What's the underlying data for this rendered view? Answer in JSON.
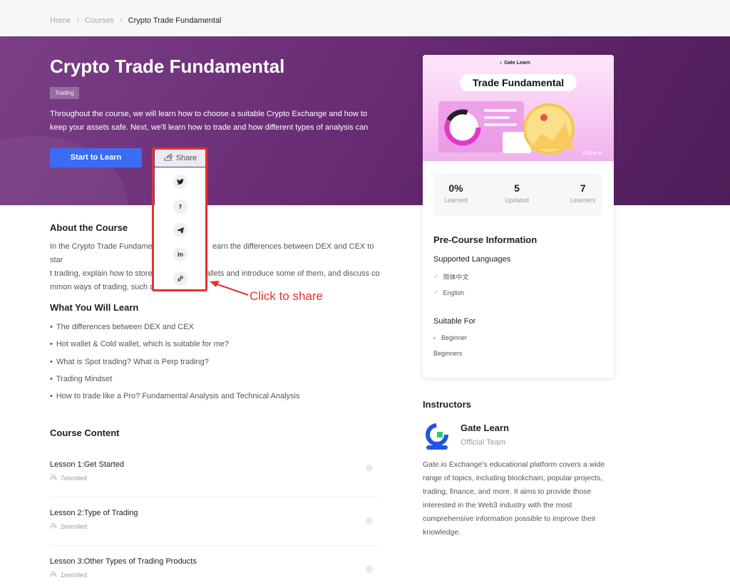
{
  "breadcrumb": {
    "items": [
      "Home",
      "Courses",
      "Crypto Trade Fundamental"
    ],
    "separator": "›"
  },
  "hero": {
    "title": "Crypto Trade Fundamental",
    "tag": "Trading",
    "description": "Throughout the course, we will learn how to choose a suitable Crypto Exchange and how to keep your assets safe. Next, we'll learn how to trade and how different types of analysis can help you m",
    "start_button": "Start to Learn",
    "share_button": "Share"
  },
  "share_menu": {
    "items": [
      "twitter",
      "facebook",
      "telegram",
      "linkedin",
      "link"
    ],
    "item_glyphs": [
      "𝕥",
      "f",
      "➤",
      "in",
      "⛓"
    ]
  },
  "annotation": {
    "label": "Click to share",
    "color": "#e5312f"
  },
  "about": {
    "title": "About the Course",
    "text_left": "In the Crypto Trade Fundamen",
    "text_right": "earn the differences between DEX and CEX to star",
    "line2_left": "t trading, explain how to store",
    "line2_right": "allets and introduce some of them, and discuss co",
    "line3_left": "mmon ways of trading, such a"
  },
  "learn": {
    "title": "What You Will Learn",
    "items": [
      "The differences between DEX and CEX",
      "Hot wallet & Cold wallet, which is suitable for me?",
      "What is Spot trading? What is Perp trading?",
      "Trading Mindset",
      "How to trade like a Pro? Fundamental Analysis and Technical Analysis"
    ]
  },
  "content": {
    "title": "Course Content",
    "lessons": [
      {
        "name": "Lesson 1:Get Started",
        "enrolled": "7enrolled"
      },
      {
        "name": "Lesson 2:Type of Trading",
        "enrolled": "2enrolled"
      },
      {
        "name": "Lesson 3:Other Types of Trading Products",
        "enrolled": "1enrolled"
      }
    ]
  },
  "card": {
    "logo": "Gate Learn",
    "banner_title": "Trade Fundamental",
    "stats": [
      {
        "value": "0%",
        "label": "Learned"
      },
      {
        "value": "5",
        "label": "Updated"
      },
      {
        "value": "7",
        "label": "Learners"
      }
    ],
    "pre_title": "Pre-Course Information",
    "languages_title": "Supported Languages",
    "languages": [
      "简体中文",
      "English"
    ],
    "suitable_title": "Suitable For",
    "suitable_level": "Beginner",
    "suitable_note": "Beginners"
  },
  "instructors": {
    "title": "Instructors",
    "name": "Gate Learn",
    "role": "Official Team",
    "description": "Gate.io Exchange's educational platform covers a wide range of topics, including blockchain, popular projects, trading, finance, and more. It aims to provide those interested in the Web3 industry with the most comprehensive information possible to improve their knowledge."
  },
  "colors": {
    "accent": "#3b6cf5",
    "hero": "#6b2f77",
    "highlight": "#e5312f"
  }
}
